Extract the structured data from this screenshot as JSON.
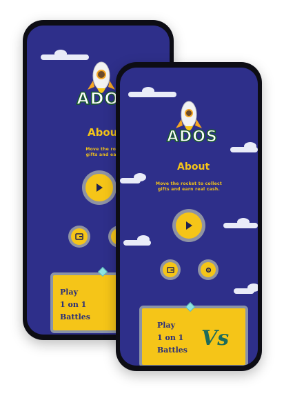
{
  "app": {
    "logo_text": "ADOS",
    "about_title": "About",
    "description_line1": "Move the rocket to collect",
    "description_line2": "gifts and earn real cash.",
    "back_description_line1": "Move the rocket to",
    "back_description_line2": "gifts and earn real",
    "battle_line1": "Play",
    "battle_line2": "1 on 1",
    "battle_line3": "Battles",
    "vs_label": "Vs"
  },
  "icons": {
    "play": "play-icon",
    "wallet": "wallet-icon",
    "settings": "gear-icon",
    "rocket": "rocket-icon",
    "gem": "gem-icon"
  },
  "colors": {
    "background": "#2e2f8a",
    "accent": "#f5c518",
    "vs": "#1d6b5a",
    "cloud": "#e9ecf8"
  }
}
